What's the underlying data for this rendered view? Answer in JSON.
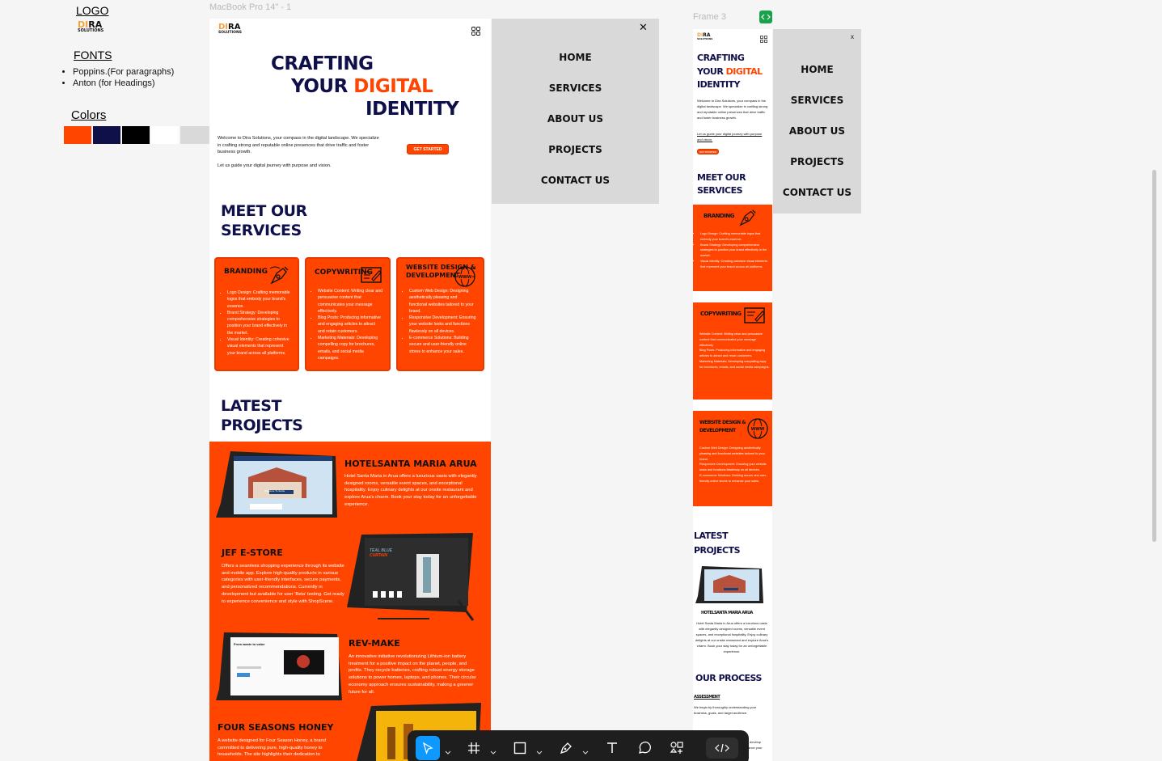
{
  "design_system": {
    "logo_heading": "LOGO",
    "logo": {
      "dira_first": "DI",
      "dira_rest": "RA",
      "solutions": "SOLUTIONS"
    },
    "fonts_heading": "FONTS",
    "fonts": [
      "Poppins.(For paragraphs)",
      "Anton (for Headings)"
    ],
    "colors_heading": "Colors",
    "colors": [
      "#ff4500",
      "#0f0f4a",
      "#000000",
      "#ffffff",
      "#d9d9d9"
    ]
  },
  "desktop_frame": {
    "label": "MacBook Pro 14\" - 1",
    "hero": {
      "line1": "CRAFTING",
      "line2a": "YOUR ",
      "line2b": "DIGITAL",
      "line3": "IDENTITY",
      "intro": "Welcome to Dira Solutions, your compass in the digital landscape. We specialize in crafting strong and reputable online presences that drive traffic and foster business growth.",
      "intro2": "Let us guide your digital journey with purpose and vision.",
      "cta": "GET STARTED"
    },
    "services_heading_1": "MEET OUR",
    "services_heading_2": "SERVICES",
    "services": [
      {
        "title": "BRANDING",
        "icon": "pen-tool-icon",
        "items": [
          "Logo Design: Crafting memorable logos that embody your brand's essence.",
          "Brand Strategy: Developing comprehensive strategies to position your brand effectively in the market.",
          "Visual Identity: Creating cohesive visual elements that represent your brand across all platforms."
        ]
      },
      {
        "title": "COPYWRITING",
        "icon": "document-pencil-icon",
        "items": [
          "Website Content: Writing clear and persuasive content that communicates your message effectively.",
          "Blog Posts: Producing informative and engaging articles to attract and retain customers.",
          "Marketing Materials: Developing compelling copy for brochures, emails, and social media campaigns."
        ]
      },
      {
        "title_1": "WEBSITE DESIGN &",
        "title_2": "DEVELOPMENT",
        "icon": "globe-www-icon",
        "items": [
          "Custom Web Design: Designing aesthetically pleasing and functional websites tailored to your brand.",
          "Responsive Development: Ensuring your website looks and functions flawlessly on all devices.",
          "E-commerce Solutions: Building secure and user-friendly online stores to enhance your sales."
        ]
      }
    ],
    "projects_heading_1": "LATEST",
    "projects_heading_2": "PROJECTS",
    "projects": [
      {
        "title": "HOTELSANTA MARIA ARUA",
        "desc": "Hotel Santa Maria in Arua offers a luxurious oasis with elegantly designed rooms, versatile event spaces, and exceptional hospitality. Enjoy culinary delights at our onsite restaurant and explore Arua's charm. Book your stay today for an unforgettable experience.",
        "mock_text": "Welcome To Santa"
      },
      {
        "title": "JEF E-STORE",
        "desc": "Offers a seamless shopping experience through its website and mobile app. Explore high-quality products in various categories with user-friendly interfaces, secure payments, and personalized recommendations. Currently in development but available for user 'Beta' testing. Get ready to experience convenience and style with ShopScene.",
        "mock_text_a": "TEAL BLUE",
        "mock_text_b": "CURTAIN"
      },
      {
        "title": "REV-MAKE",
        "desc": "An innovative initiative revolutionizing Lithium-ion battery treatment for a positive impact on the planet, people, and profits. They recycle batteries, crafting robust energy storage solutions to power homes, laptops, and phones. Their circular economy approach ensures sustainability, making a greener future for all.",
        "mock_text": "From waste to value"
      },
      {
        "title": "FOUR SEASONS HONEY",
        "desc": "A website designed for Four Season Honey, a brand committed to delivering pure, high-quality honey to households. The site highlights their dedication to"
      }
    ]
  },
  "menu_overlay": {
    "close": "✕",
    "items": [
      "HOME",
      "SERVICES",
      "ABOUT US",
      "PROJECTS",
      "CONTACT US"
    ]
  },
  "mobile_frame": {
    "label": "Frame 3",
    "hero_1": "CRAFTING",
    "hero_2a": "YOUR ",
    "hero_2b": "DIGITAL",
    "hero_3": "IDENTITY",
    "intro": "Welcome to Dira Solutions, your compass in the digital landscape. We specialize in crafting strong and reputable online presences that drive traffic and foster business growth.",
    "intro2": "Let us guide your digital journey with purpose and vision.",
    "cta": "GET STARTED",
    "services_1": "MEET OUR",
    "services_2": "SERVICES",
    "cards": [
      {
        "title": "BRANDING",
        "items": [
          "Logo Design: Crafting memorable logos that embody your brand's essence.",
          "Brand Strategy: Developing comprehensive strategies to position your brand effectively in the market.",
          "Visual Identity: Creating cohesive visual elements that represent your brand across all platforms."
        ]
      },
      {
        "title": "COPYWRITING",
        "items": [
          "Website Content: Writing clear and persuasive content that communicates your message effectively.",
          "Blog Posts: Producing informative and engaging articles to attract and retain customers.",
          "Marketing Materials: Developing compelling copy for brochures, emails, and social media campaigns."
        ]
      },
      {
        "title_1": "WEBSITE DESIGN &",
        "title_2": "DEVELOPMENT",
        "items": [
          "Custom Web Design: Designing aesthetically pleasing and functional websites tailored to your brand.",
          "Responsive Development: Ensuring your website looks and functions flawlessly on all devices.",
          "E-commerce Solutions: Building secure and user-friendly online stores to enhance your sales."
        ]
      }
    ],
    "projects_1": "LATEST",
    "projects_2": "PROJECTS",
    "project_title": "HOTELSANTA MARIA ARUA",
    "project_desc": "Hotel Santa Maria in Arua offers a luxurious oasis with elegantly designed rooms, versatile event spaces, and exceptional hospitality. Enjoy culinary delights at our onsite restaurant and explore Arua's charm. Book your stay today for an unforgettable experience.",
    "process_heading": "OUR PROCESS",
    "process_step": "ASSESSMENT",
    "process_desc": "We begin by thoroughly understanding your business, goals, and target audience.",
    "process_desc2a": "develop",
    "process_desc2b": "ance your"
  },
  "mobile_menu": {
    "close": "x",
    "items": [
      "HOME",
      "SERVICES",
      "ABOUT US",
      "PROJECTS",
      "CONTACT US"
    ]
  },
  "toolbar": {
    "tools": [
      "move-icon",
      "frame-icon",
      "rectangle-icon",
      "pen-icon",
      "text-icon",
      "comment-icon",
      "components-icon",
      "dev-mode-icon"
    ]
  }
}
